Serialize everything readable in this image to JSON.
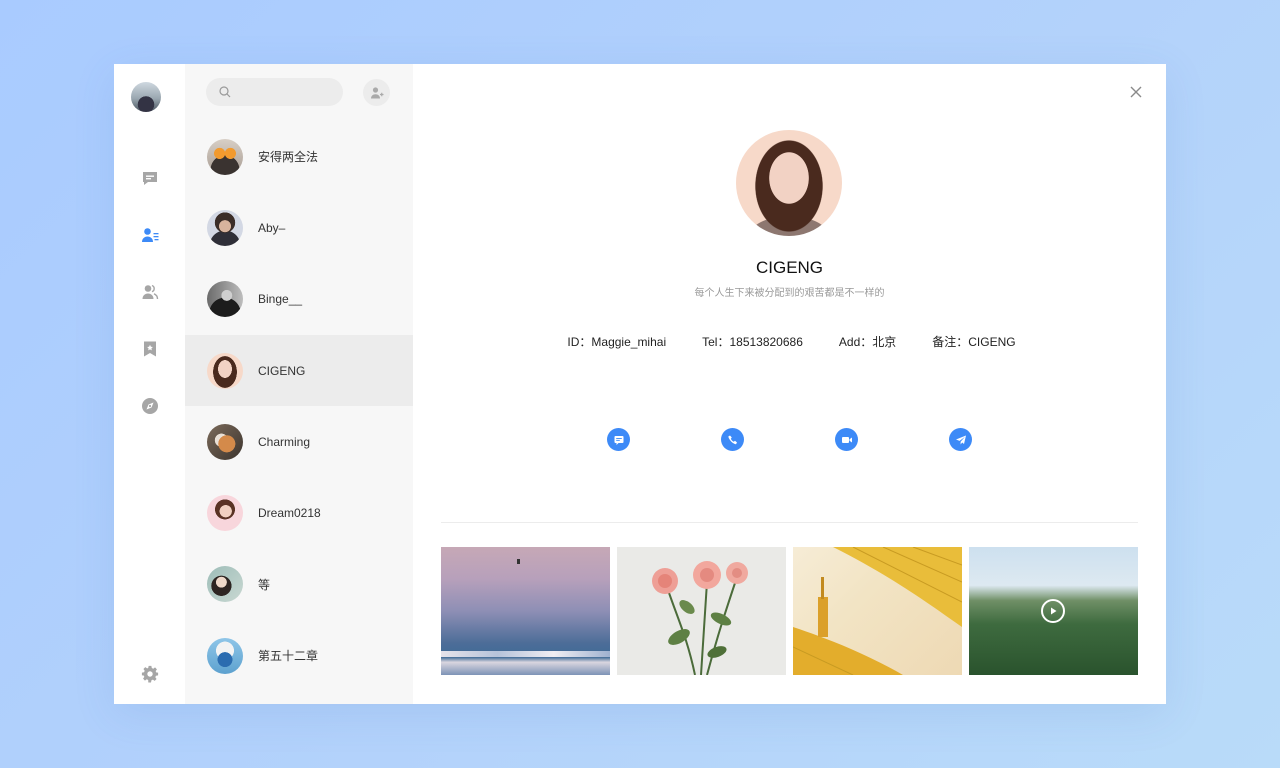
{
  "search": {
    "placeholder": ""
  },
  "nav": {
    "items": [
      {
        "icon": "chat-icon",
        "active": false
      },
      {
        "icon": "contacts-icon",
        "active": true
      },
      {
        "icon": "group-icon",
        "active": false
      },
      {
        "icon": "bookmark-icon",
        "active": false
      },
      {
        "icon": "compass-icon",
        "active": false
      }
    ],
    "settings_icon": "gear-icon"
  },
  "contacts": [
    {
      "name": "安得两全法"
    },
    {
      "name": "Aby–"
    },
    {
      "name": "Binge__"
    },
    {
      "name": "CIGENG",
      "active": true
    },
    {
      "name": "Charming"
    },
    {
      "name": "Dream0218"
    },
    {
      "name": "等"
    },
    {
      "name": "第五十二章"
    }
  ],
  "profile": {
    "name": "CIGENG",
    "signature": "每个人生下来被分配到的艰苦都是不一样的",
    "id": "ID：Maggie_mihai",
    "tel": "Tel：18513820686",
    "add": "Add：北京",
    "note": "备注：CIGENG"
  },
  "actions": [
    "message-icon",
    "phone-icon",
    "video-icon",
    "send-icon"
  ],
  "media": [
    "sea-photo",
    "roses-photo",
    "umbrella-photo",
    "forest-video"
  ],
  "colors": {
    "accent": "#3d8af7",
    "nav_icon": "#a6a6a6",
    "list_bg": "#f7f7f7"
  }
}
